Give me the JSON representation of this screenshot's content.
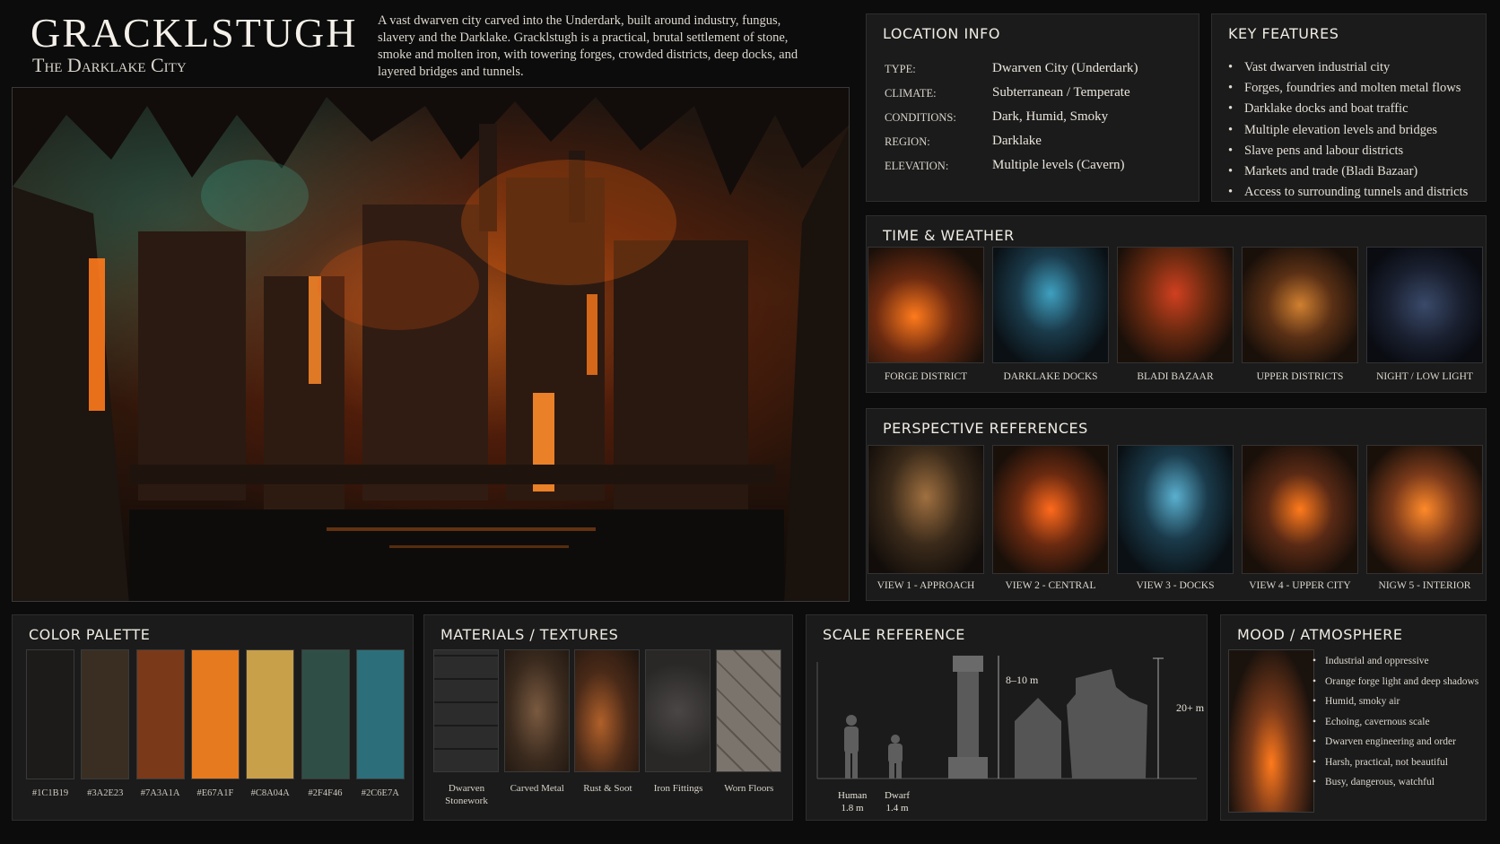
{
  "header": {
    "title": "GRACKLSTUGH",
    "subtitle": "The Darklake City",
    "intro": "A vast dwarven city carved into the Underdark, built around industry, fungus, slavery and the Darklake. Gracklstugh is a practical, brutal settlement of stone, smoke and molten iron, with towering forges, crowded districts, deep docks, and layered bridges and tunnels."
  },
  "location_info": {
    "title": "LOCATION INFO",
    "rows": [
      {
        "key": "TYPE:",
        "value": "Dwarven City (Underdark)"
      },
      {
        "key": "CLIMATE:",
        "value": "Subterranean / Temperate"
      },
      {
        "key": "CONDITIONS:",
        "value": "Dark, Humid, Smoky"
      },
      {
        "key": "REGION:",
        "value": "Darklake"
      },
      {
        "key": "ELEVATION:",
        "value": "Multiple levels (Cavern)"
      }
    ]
  },
  "key_features": {
    "title": "KEY FEATURES",
    "items": [
      "Vast dwarven industrial city",
      "Forges, foundries and molten metal flows",
      "Darklake docks and boat traffic",
      "Multiple elevation levels and bridges",
      "Slave pens and labour districts",
      "Markets and trade (Bladi Bazaar)",
      "Access to surrounding tunnels and districts"
    ]
  },
  "time_weather": {
    "title": "TIME & WEATHER",
    "items": [
      {
        "label": "FORGE DISTRICT"
      },
      {
        "label": "DARKLAKE DOCKS"
      },
      {
        "label": "BLADI BAZAAR"
      },
      {
        "label": "UPPER DISTRICTS"
      },
      {
        "label": "NIGHT / LOW LIGHT"
      }
    ]
  },
  "perspective": {
    "title": "PERSPECTIVE REFERENCES",
    "items": [
      {
        "label": "VIEW 1 - APPROACH"
      },
      {
        "label": "VIEW 2 - CENTRAL"
      },
      {
        "label": "VIEW 3 - DOCKS"
      },
      {
        "label": "VIEW 4 - UPPER CITY"
      },
      {
        "label": "NIGW 5 - INTERIOR"
      }
    ]
  },
  "palette": {
    "title": "COLOR PALETTE",
    "swatches": [
      {
        "hex": "#1C1B19",
        "label": "#1C1B19"
      },
      {
        "hex": "#3A2E23",
        "label": "#3A2E23"
      },
      {
        "hex": "#7A3A1A",
        "label": "#7A3A1A"
      },
      {
        "hex": "#E67A1F",
        "label": "#E67A1F"
      },
      {
        "hex": "#C8A04A",
        "label": "#C8A04A"
      },
      {
        "hex": "#2F4F46",
        "label": "#2F4F46"
      },
      {
        "hex": "#2C6E7A",
        "label": "#2C6E7A"
      }
    ]
  },
  "materials": {
    "title": "MATERIALS / TEXTURES",
    "items": [
      {
        "label": "Dwarven Stonework"
      },
      {
        "label": "Carved Metal"
      },
      {
        "label": "Rust & Soot"
      },
      {
        "label": "Iron Fittings"
      },
      {
        "label": "Worn Floors"
      }
    ]
  },
  "scale": {
    "title": "SCALE REFERENCE",
    "human_name": "Human",
    "human_height": "1.8 m",
    "dwarf_name": "Dwarf",
    "dwarf_height": "1.4 m",
    "pillar_height": "8–10 m",
    "building_height": "20+ m"
  },
  "mood": {
    "title": "MOOD / ATMOSPHERE",
    "items": [
      "Industrial and oppressive",
      "Orange forge light and deep shadows",
      "Humid, smoky air",
      "Echoing, cavernous scale",
      "Dwarven engineering and order",
      "Harsh, practical, not beautiful",
      "Busy, dangerous, watchful"
    ]
  }
}
